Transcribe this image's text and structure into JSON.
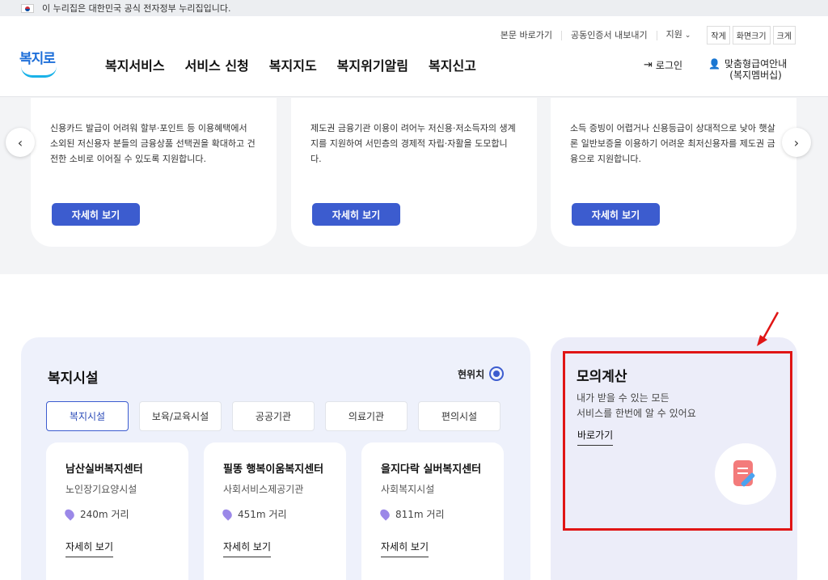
{
  "gov_banner": {
    "text": "이 누리집은 대한민국 공식 전자정부 누리집입니다."
  },
  "header": {
    "logo_text": "복지로",
    "util_links": [
      "본문 바로가기",
      "공동인증서 내보내기",
      "지원"
    ],
    "font_controls": [
      "작게",
      "화면크기",
      "크게"
    ],
    "nav": [
      "복지서비스",
      "서비스 신청",
      "복지지도",
      "복지위기알림",
      "복지신고"
    ],
    "login": "로그인",
    "custom_info_line1": "맞춤형급여안내",
    "custom_info_line2": "(복지멤버십)"
  },
  "cards": [
    {
      "desc": "신용카드 발급이 어려워 할부·포인트 등 이용혜택에서 소외된 저신용자 분들의 금융상품 선택권을 확대하고 건전한 소비로 이어질 수 있도록 지원합니다.",
      "button": "자세히 보기"
    },
    {
      "desc": "제도권 금융기관 이용이 려어누 저신용·저소득자의 생계지를 지원하여 서민층의 경제적 자립·자활을 도모합니다.",
      "button": "자세히 보기"
    },
    {
      "desc": "소득 증빙이 어렵거나 신용등급이 상대적으로 낮아 햇살론 일반보증을 이용하기 어려운 최저신용자를 제도권 금융으로 지원합니다.",
      "button": "자세히 보기"
    }
  ],
  "facility": {
    "title": "복지시설",
    "location": "현위치",
    "tabs": [
      "복지시설",
      "보육/교육시설",
      "공공기관",
      "의료기관",
      "편의시설"
    ],
    "items": [
      {
        "name": "남산실버복지센터",
        "type": "노인장기요양시설",
        "distance": "240m 거리",
        "more": "자세히 보기"
      },
      {
        "name": "필똥 행복이움복지센터",
        "type": "사회서비스제공기관",
        "distance": "451m 거리",
        "more": "자세히 보기"
      },
      {
        "name": "을지다락 실버복지센터",
        "type": "사회복지시설",
        "distance": "811m 거리",
        "more": "자세히 보기"
      }
    ]
  },
  "mock": {
    "title": "모의계산",
    "desc_line1": "내가 받을 수 있는 모든",
    "desc_line2": "서비스를 한번에 알 수 있어요",
    "link": "바로가기"
  },
  "colors": {
    "accent": "#3c5ccf",
    "highlight": "#e01515"
  }
}
